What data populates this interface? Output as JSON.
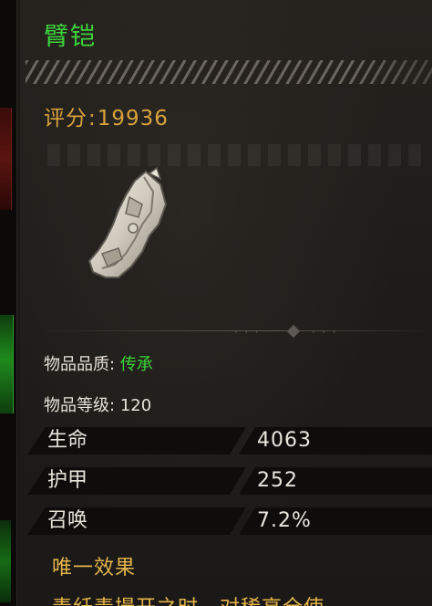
{
  "item": {
    "name": "臂铠",
    "score_label": "评分",
    "score_value": "19936",
    "quality_label": "物品品质:",
    "quality_value": "传承",
    "level_label": "物品等级:",
    "level_value": "120"
  },
  "stats": [
    {
      "name": "生命",
      "value": "4063"
    },
    {
      "name": "护甲",
      "value": "252"
    },
    {
      "name": "召唤",
      "value": "7.2%"
    }
  ],
  "unique_effect": {
    "title": "唯一效果",
    "text_partial": "毒纤毒撮开之时，对稀高全使"
  },
  "colors": {
    "name_green": "#3cd43a",
    "score_gold": "#d9a23b",
    "unique_gold": "#e6b54a"
  }
}
